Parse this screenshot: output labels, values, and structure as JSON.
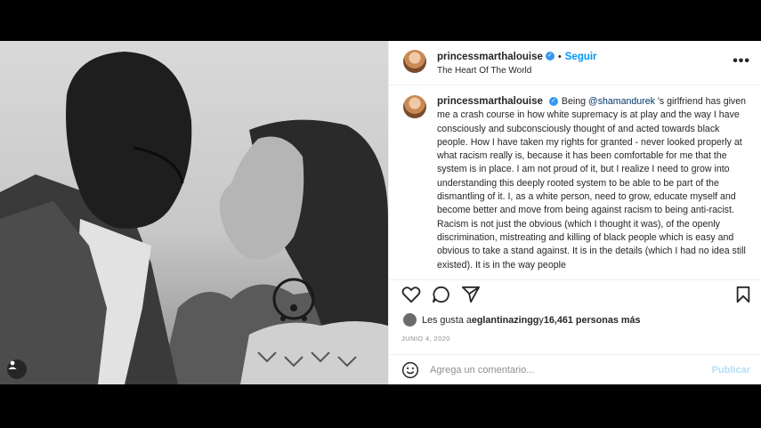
{
  "header": {
    "username": "princessmarthalouise",
    "follow_label": "Seguir",
    "separator": "•",
    "location": "The Heart Of The World",
    "more_label": "•••"
  },
  "caption": {
    "username": "princessmarthalouise",
    "intro": "Being ",
    "mention": "@shamandurek",
    "text": " 's girlfriend has given me a crash course in how white supremacy is at play and the way I have consciously and subconsciously thought of and acted towards black people. How I have taken my rights for granted - never looked properly at what racism really is, because it has been comfortable for me that the system is in place. I am not proud of it, but I realize I need to grow into understanding this deeply rooted system to be able to be part of the dismantling of it. I, as a white person, need to grow, educate myself and become better and move from being against racism to being anti-racist.",
    "text2": "Racism is not just the obvious (which I thought it was), of the openly discrimination, mistreating and killing of black people which is easy and obvious to take a stand against. It is in the details (which I had no idea still existed). It is in the way people"
  },
  "likes": {
    "prefix": "Les gusta a ",
    "user": "eglantinazingg",
    "middle": " y ",
    "count": "16,461 personas más"
  },
  "date": "JUNIO 4, 2020",
  "comment": {
    "placeholder": "Agrega un comentario...",
    "publish_label": "Publicar"
  },
  "colors": {
    "accent": "#0095f6",
    "verified": "#3897f0",
    "mention": "#00376b"
  },
  "icons": [
    "heart-icon",
    "comment-icon",
    "share-icon",
    "bookmark-icon",
    "emoji-icon",
    "user-tag-icon",
    "verified-badge-icon"
  ]
}
